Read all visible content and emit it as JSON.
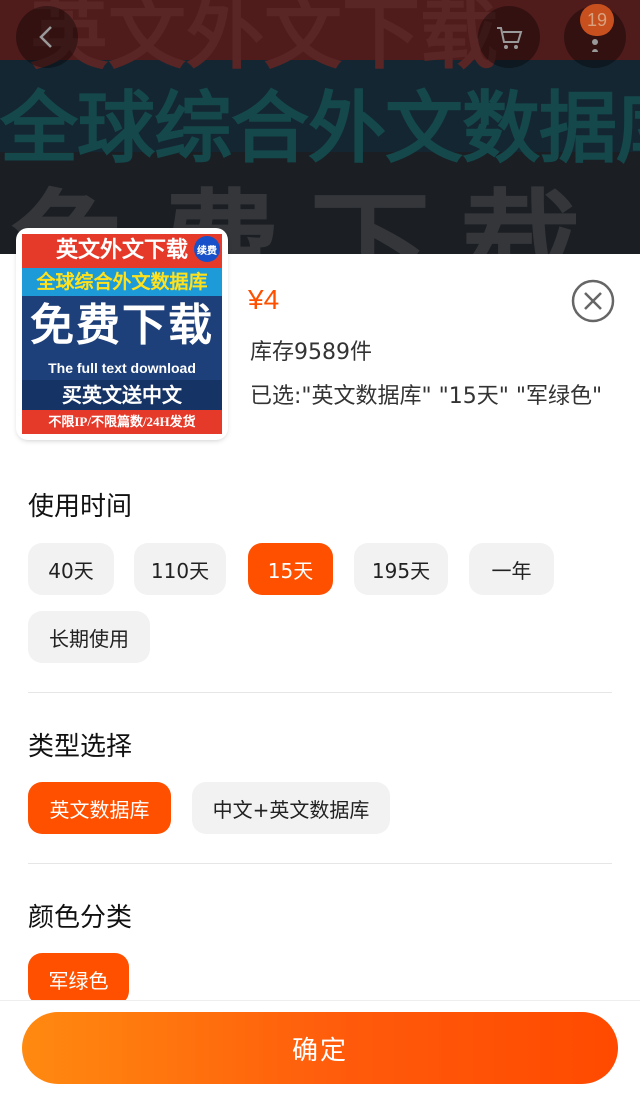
{
  "backdrop": {
    "line1": "英文外文下载",
    "line2": "全球综合外文数据库",
    "line3": "免费下载"
  },
  "topbar": {
    "back_icon": "chevron-left-icon",
    "cart_icon": "cart-icon",
    "more_icon": "more-vertical-icon",
    "cart_count": "19"
  },
  "product": {
    "thumb": {
      "l1": "英文外文下载",
      "badge": "续费",
      "l2": "全球综合外文数据库",
      "l3": "免费下载",
      "l4": "The full text download",
      "l5": "买英文送中文",
      "l6": "不限IP/不限篇数/24H发货"
    },
    "price": "¥4",
    "stock": "库存9589件",
    "selected": "已选:\"英文数据库\" \"15天\" \"军绿色\""
  },
  "sections": {
    "time": {
      "title": "使用时间",
      "options": [
        "40天",
        "110天",
        "15天",
        "195天",
        "一年",
        "长期使用"
      ],
      "selected_index": 2
    },
    "type": {
      "title": "类型选择",
      "options": [
        "英文数据库",
        "中文+英文数据库"
      ],
      "selected_index": 0
    },
    "color": {
      "title": "颜色分类",
      "options": [
        "军绿色"
      ],
      "selected_index": 0
    }
  },
  "footer": {
    "confirm_label": "确定"
  },
  "colors": {
    "accent": "#ff5000",
    "chip_bg": "#f2f2f2"
  }
}
